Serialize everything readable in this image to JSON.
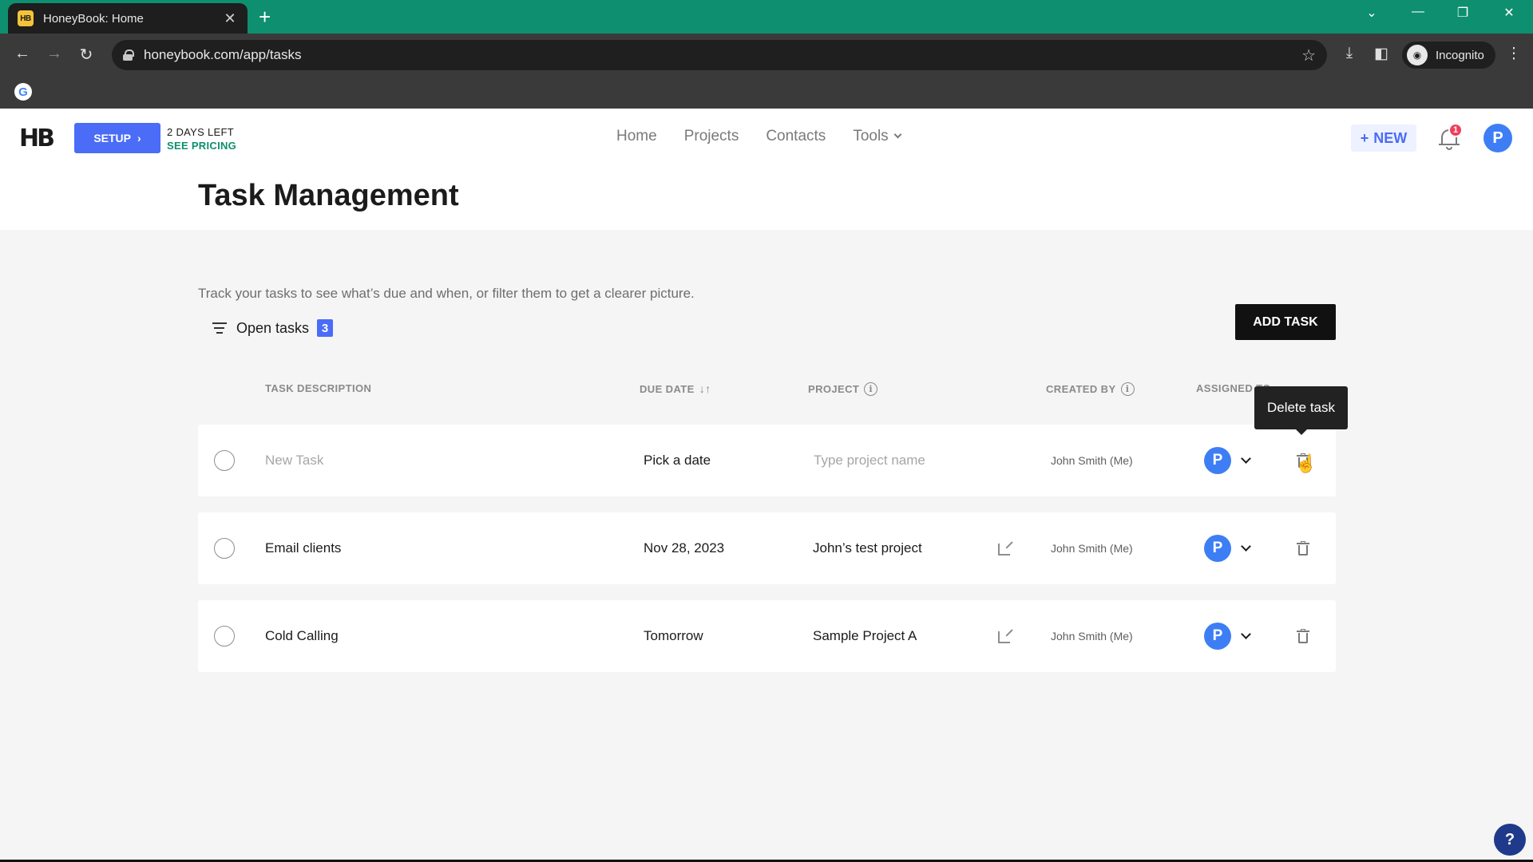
{
  "browser": {
    "tab_title": "HoneyBook: Home",
    "favicon_text": "HB",
    "url": "honeybook.com/app/tasks",
    "profile_label": "Incognito"
  },
  "header": {
    "logo": "HB",
    "setup_label": "SETUP",
    "trial_text": "2 DAYS LEFT",
    "pricing_link": "SEE PRICING",
    "nav": [
      "Home",
      "Projects",
      "Contacts",
      "Tools"
    ],
    "new_label": "NEW",
    "notification_count": "1",
    "avatar_initial": "P",
    "page_title": "Task Management"
  },
  "main": {
    "intro": "Track your tasks to see what’s due and when, or filter them to get a clearer picture.",
    "filter_label": "Open tasks",
    "filter_count": "3",
    "add_task_label": "ADD TASK",
    "columns": {
      "task": "TASK DESCRIPTION",
      "due": "DUE DATE",
      "project": "PROJECT",
      "created": "CREATED BY",
      "assigned": "ASSIGNED TO"
    },
    "new_row": {
      "task_placeholder": "New Task",
      "date_placeholder": "Pick a date",
      "project_placeholder": "Type project name",
      "created_by": "John Smith (Me)",
      "assignee_initial": "P"
    },
    "rows": [
      {
        "task": "Email clients",
        "due": "Nov 28, 2023",
        "project": "John’s test project",
        "created_by": "John Smith (Me)",
        "assignee_initial": "P"
      },
      {
        "task": "Cold Calling",
        "due": "Tomorrow",
        "project": "Sample Project A",
        "created_by": "John Smith (Me)",
        "assignee_initial": "P"
      }
    ],
    "tooltip": "Delete task"
  },
  "help_label": "?",
  "colors": {
    "tab_bar": "#0e8f6f",
    "accent": "#4a6cf7",
    "avatar": "#3e7ef5",
    "badge": "#f03e5c"
  }
}
